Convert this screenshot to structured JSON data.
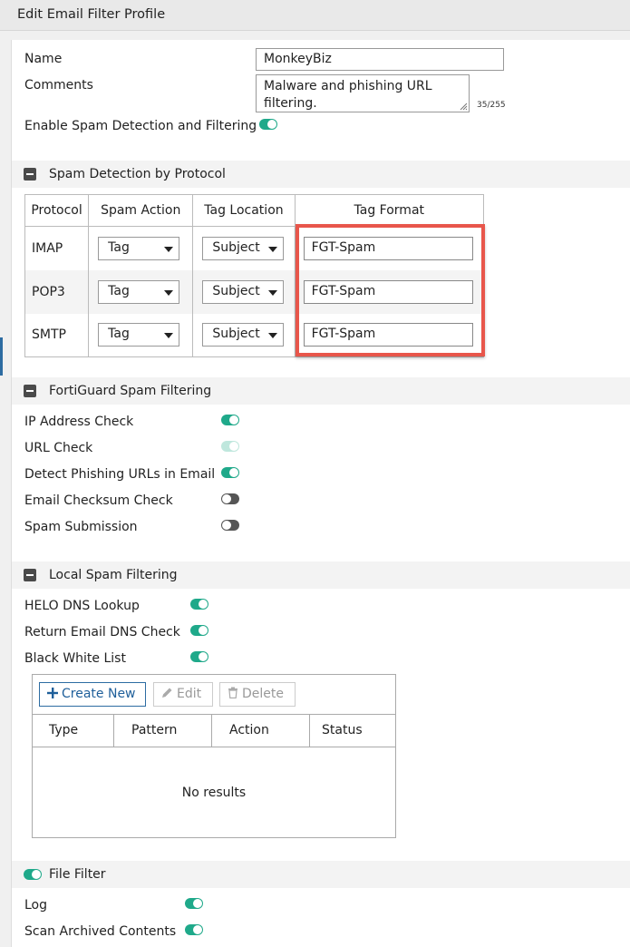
{
  "window": {
    "title": "Edit Email Filter Profile"
  },
  "form": {
    "name_label": "Name",
    "name_value": "MonkeyBiz",
    "comments_label": "Comments",
    "comments_value": "Malware and phishing URL filtering.",
    "comments_counter": "35/255",
    "enable_spam_label": "Enable Spam Detection and Filtering",
    "enable_spam_on": true
  },
  "spam_protocol": {
    "section_title": "Spam Detection by Protocol",
    "headers": [
      "Protocol",
      "Spam Action",
      "Tag Location",
      "Tag Format"
    ],
    "rows": [
      {
        "protocol": "IMAP",
        "action": "Tag",
        "location": "Subject",
        "format": "FGT-Spam"
      },
      {
        "protocol": "POP3",
        "action": "Tag",
        "location": "Subject",
        "format": "FGT-Spam"
      },
      {
        "protocol": "SMTP",
        "action": "Tag",
        "location": "Subject",
        "format": "FGT-Spam"
      }
    ]
  },
  "fortiguard": {
    "section_title": "FortiGuard Spam Filtering",
    "items": [
      {
        "label": "IP Address Check",
        "state": "on"
      },
      {
        "label": "URL Check",
        "state": "disabled-on"
      },
      {
        "label": "Detect Phishing URLs in Email",
        "state": "on"
      },
      {
        "label": "Email Checksum Check",
        "state": "off"
      },
      {
        "label": "Spam Submission",
        "state": "off"
      }
    ]
  },
  "local": {
    "section_title": "Local Spam Filtering",
    "items": [
      {
        "label": "HELO DNS Lookup",
        "state": "on"
      },
      {
        "label": "Return Email DNS Check",
        "state": "on"
      },
      {
        "label": "Black White List",
        "state": "on"
      }
    ],
    "bwl": {
      "create_label": "Create New",
      "edit_label": "Edit",
      "delete_label": "Delete",
      "columns": [
        "Type",
        "Pattern",
        "Action",
        "Status"
      ],
      "empty_text": "No results"
    }
  },
  "file_filter": {
    "section_title": "File Filter",
    "enabled": true,
    "items": [
      {
        "label": "Log",
        "state": "on"
      },
      {
        "label": "Scan Archived Contents",
        "state": "on"
      }
    ]
  },
  "colors": {
    "toggle_on": "#1fa98a",
    "toggle_off": "#555555",
    "highlight": "#e8564b",
    "accent": "#2d6ca2"
  }
}
